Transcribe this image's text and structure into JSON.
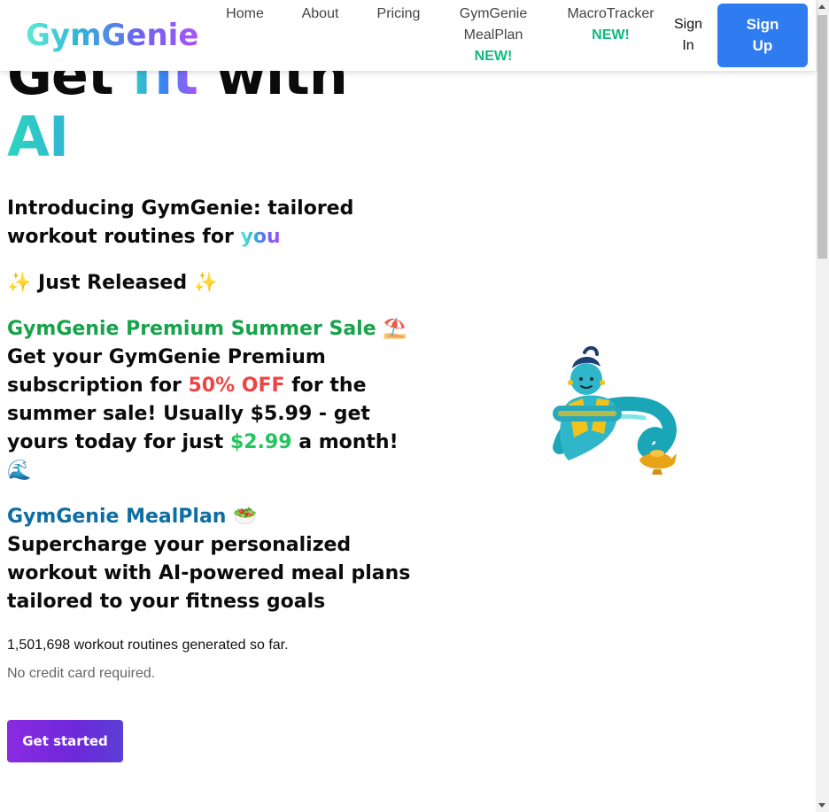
{
  "brand": {
    "logo": "GymGenie"
  },
  "nav": {
    "items": [
      {
        "label": "Home",
        "badge": ""
      },
      {
        "label": "About",
        "badge": ""
      },
      {
        "label": "Pricing",
        "badge": ""
      },
      {
        "label_line1": "GymGenie",
        "label_line2": "MealPlan",
        "badge": "NEW!"
      },
      {
        "label": "MacroTracker",
        "badge": "NEW!"
      }
    ],
    "sign_in_line1": "Sign",
    "sign_in_line2": "In",
    "sign_up_line1": "Sign",
    "sign_up_line2": "Up"
  },
  "hero": {
    "title_prefix": "Get ",
    "title_fit": "fit",
    "title_with": " with",
    "title_ai": "AI"
  },
  "intro": {
    "text": "Introducing GymGenie: tailored workout routines for ",
    "highlight": "you"
  },
  "released": {
    "text": "✨ Just Released ✨"
  },
  "sale": {
    "heading": "GymGenie Premium Summer Sale",
    "heading_emoji": "⛱️",
    "part1": "Get your GymGenie Premium subscription for ",
    "discount": "50% OFF",
    "part2": " for the summer sale! Usually $5.99 - get yours today for just ",
    "price": "$2.99",
    "part3": " a month!",
    "trailing_emoji": "🌊"
  },
  "mealplan": {
    "heading": "GymGenie MealPlan",
    "heading_emoji": "🥗",
    "text": "Supercharge your personalized workout with AI-powered meal plans tailored to your fitness goals"
  },
  "stats": {
    "count_text": "1,501,698 workout routines generated so far.",
    "note": "No credit card required."
  },
  "cta": {
    "label": "Get started"
  },
  "colors": {
    "signup_bg": "#2f7cf0",
    "new_badge": "#10b981",
    "sale_heading": "#16a34a",
    "mealplan_heading": "#0e6ea3",
    "discount": "#ef4444",
    "price": "#22c55e",
    "cta_bg": "#7c2ae8"
  },
  "icons": {
    "hero_illustration": "genie-icon"
  }
}
